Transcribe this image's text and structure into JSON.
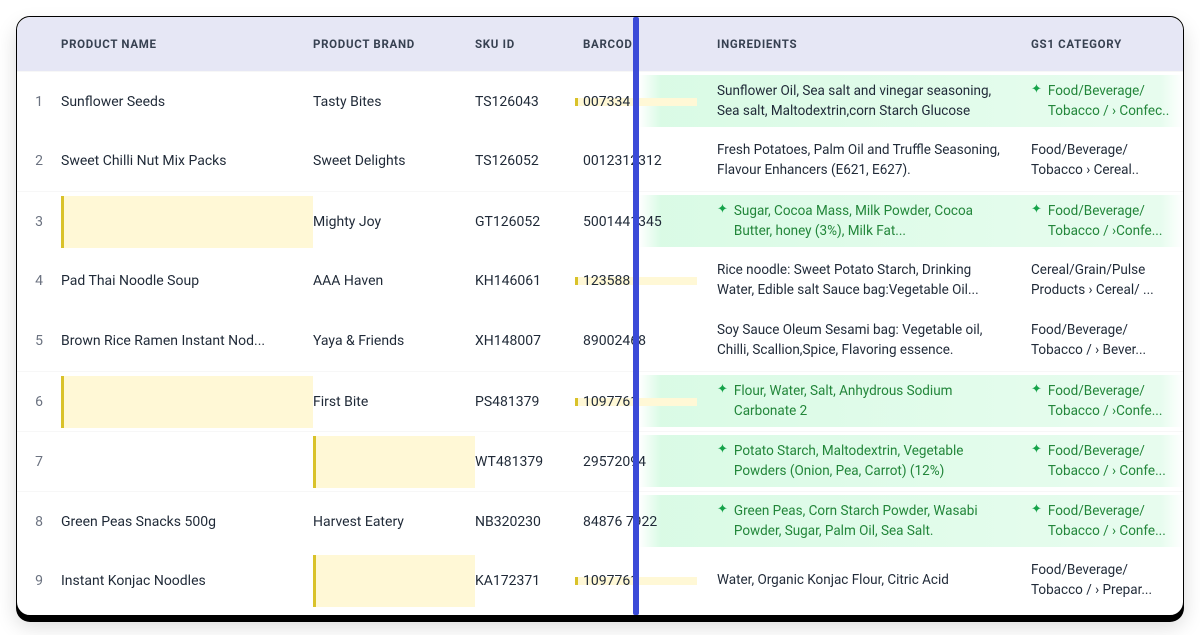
{
  "headers": {
    "name": "PRODUCT NAME",
    "brand": "PRODUCT BRAND",
    "sku": "SKU ID",
    "barcode": "BARCODE",
    "ingredients": "INGREDIENTS",
    "category": "GS1 CATEGORY"
  },
  "icons": {
    "sparkle": "✦"
  },
  "rows": [
    {
      "n": "1",
      "name": "Sunflower Seeds",
      "brand": "Tasty Bites",
      "sku": "TS126043",
      "barcode": "007334",
      "barcode_yellow": true,
      "ingredients": "Sunflower Oil, Sea salt and vinegar seasoning, Sea salt, Maltodextrin,corn Starch Glucose",
      "ing_ai": false,
      "category": "Food/Beverage/ Tobacco / › Confec..",
      "cat_ai": true,
      "ai_band": true
    },
    {
      "n": "2",
      "name": "Sweet Chilli Nut Mix Packs",
      "brand": "Sweet Delights",
      "sku": "TS126052",
      "barcode": "0012312312",
      "barcode_yellow": false,
      "ingredients": "Fresh Potatoes, Palm Oil and Truffle Seasoning, Flavour Enhancers (E621, E627).",
      "ing_ai": false,
      "category": "Food/Beverage/ Tobacco › Cereal..",
      "cat_ai": false,
      "ai_band": false
    },
    {
      "n": "3",
      "name": "",
      "name_yellow": true,
      "brand": "Mighty Joy",
      "sku": "GT126052",
      "barcode": "5001441345",
      "barcode_yellow": false,
      "ingredients": "Sugar, Cocoa Mass, Milk Powder, Cocoa Butter, honey (3%), Milk Fat...",
      "ing_ai": true,
      "category": "Food/Beverage/ Tobacco / ›Confe...",
      "cat_ai": true,
      "ai_band": true
    },
    {
      "n": "4",
      "name": "Pad Thai Noodle Soup",
      "brand": "AAA Haven",
      "sku": "KH146061",
      "barcode": "123588",
      "barcode_yellow": true,
      "ingredients": "Rice noodle: Sweet Potato Starch, Drinking Water, Edible salt Sauce bag:Vegetable Oil...",
      "ing_ai": false,
      "category": "Cereal/Grain/Pulse Products › Cereal/ ...",
      "cat_ai": false,
      "ai_band": false
    },
    {
      "n": "5",
      "name": "Brown Rice Ramen Instant Nod...",
      "brand": "Yaya & Friends",
      "sku": "XH148007",
      "barcode": "89002468",
      "barcode_yellow": false,
      "ingredients": "Soy Sauce Oleum Sesami bag: Vegetable oil, Chilli, Scallion,Spice, Flavoring essence.",
      "ing_ai": false,
      "category": "Food/Beverage/ Tobacco / › Bever...",
      "cat_ai": false,
      "ai_band": false
    },
    {
      "n": "6",
      "name": "",
      "name_yellow": true,
      "brand": "First Bite",
      "sku": "PS481379",
      "barcode": "1097761",
      "barcode_yellow": true,
      "ingredients": "Flour, Water, Salt, Anhydrous Sodium Carbonate 2",
      "ing_ai": true,
      "category": "Food/Beverage/ Tobacco / ›Confe...",
      "cat_ai": true,
      "ai_band": true
    },
    {
      "n": "7",
      "name": "",
      "name_yellow": false,
      "brand": "",
      "brand_yellow": true,
      "sku": "WT481379",
      "barcode": "29572094",
      "barcode_yellow": false,
      "ingredients": "Potato Starch, Maltodextrin, Vegetable Powders (Onion, Pea, Carrot) (12%)",
      "ing_ai": true,
      "category": "Food/Beverage/ Tobacco / › Confe...",
      "cat_ai": true,
      "ai_band": true
    },
    {
      "n": "8",
      "name": "Green Peas Snacks 500g",
      "brand": "Harvest Eatery",
      "sku": "NB320230",
      "barcode": "84876 7922",
      "barcode_yellow": false,
      "ingredients": "Green Peas, Corn Starch Powder, Wasabi Powder, Sugar, Palm Oil, Sea Salt.",
      "ing_ai": true,
      "category": "Food/Beverage/ Tobacco / › Confe...",
      "cat_ai": true,
      "ai_band": true
    },
    {
      "n": "9",
      "name": "Instant Konjac Noodles",
      "brand": "",
      "brand_yellow": true,
      "sku": "KA172371",
      "barcode": "1097761",
      "barcode_yellow": true,
      "ingredients": "Water, Organic Konjac Flour, Citric Acid",
      "ing_ai": false,
      "category": "Food/Beverage/ Tobacco / › Prepar...",
      "cat_ai": false,
      "ai_band": false
    }
  ]
}
